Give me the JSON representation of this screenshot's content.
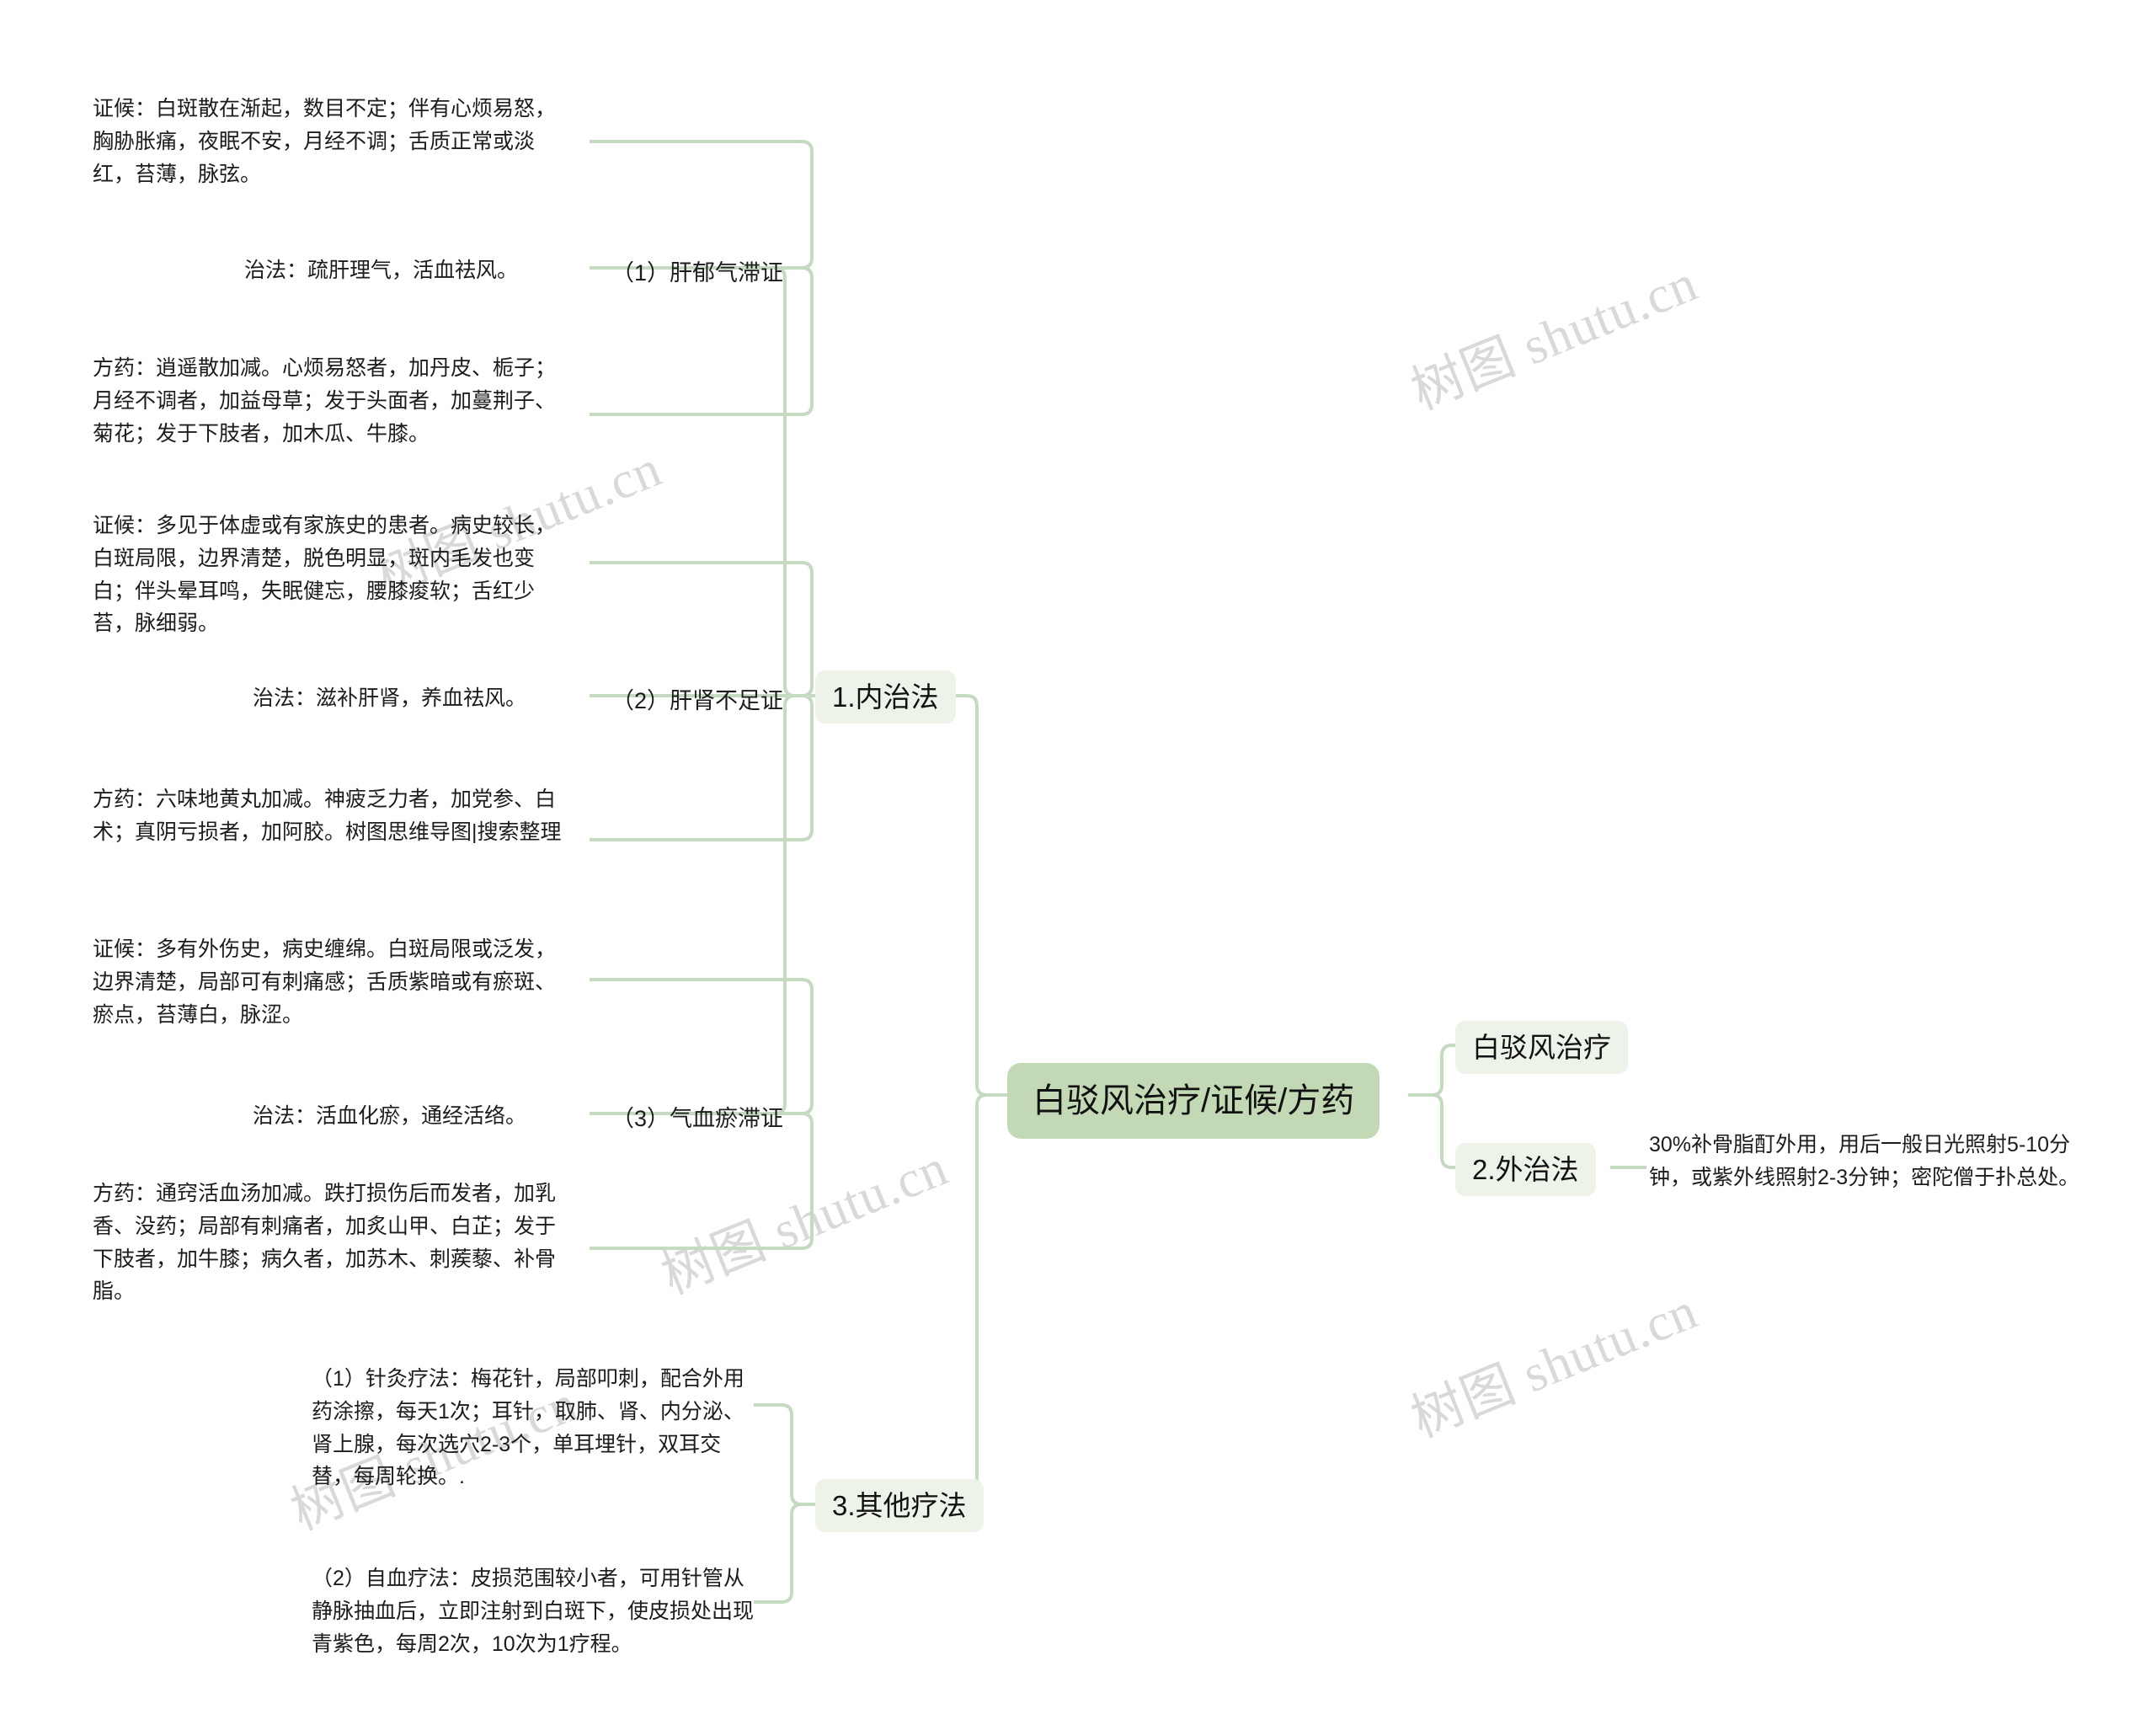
{
  "meta": {
    "diagram_type": "mindmap",
    "root_fill": "#c3d9b5",
    "branch_fill": "#edf3e9",
    "connector_color": "#c5dbc1",
    "text_color": "#1c1c1c",
    "background": "#ffffff"
  },
  "watermarks": [
    {
      "text": "树图 shutu.cn"
    },
    {
      "text": "树图 shutu.cn"
    },
    {
      "text": "树图 shutu.cn"
    },
    {
      "text": "树图 shutu.cn"
    },
    {
      "text": "树图 shutu.cn"
    }
  ],
  "root": {
    "label": "白驳风治疗/证候/方药"
  },
  "branches": [
    {
      "id": "internal",
      "label": "1.内治法",
      "children": [
        {
          "label": "（1）肝郁气滞证",
          "details": [
            {
              "kind": "zhenghou",
              "text": "证候：白斑散在渐起，数目不定；伴有心烦易怒，胸胁胀痛，夜眠不安，月经不调；舌质正常或淡红，苔薄，脉弦。"
            },
            {
              "kind": "zhifa",
              "text": "治法：疏肝理气，活血祛风。"
            },
            {
              "kind": "fangyao",
              "text": "方药：逍遥散加减。心烦易怒者，加丹皮、栀子；月经不调者，加益母草；发于头面者，加蔓荆子、菊花；发于下肢者，加木瓜、牛膝。"
            }
          ]
        },
        {
          "label": "（2）肝肾不足证",
          "details": [
            {
              "kind": "zhenghou",
              "text": "证候：多见于体虚或有家族史的患者。病史较长，白斑局限，边界清楚，脱色明显，斑内毛发也变白；伴头晕耳鸣，失眠健忘，腰膝痠软；舌红少苔，脉细弱。"
            },
            {
              "kind": "zhifa",
              "text": "治法：滋补肝肾，养血祛风。"
            },
            {
              "kind": "fangyao",
              "text": "方药：六味地黄丸加减。神疲乏力者，加党参、白术；真阴亏损者，加阿胶。树图思维导图|搜索整理"
            }
          ]
        },
        {
          "label": "（3）气血瘀滞证",
          "details": [
            {
              "kind": "zhenghou",
              "text": "证候：多有外伤史，病史缠绵。白斑局限或泛发，边界清楚，局部可有刺痛感；舌质紫暗或有瘀斑、瘀点，苔薄白，脉涩。"
            },
            {
              "kind": "zhifa",
              "text": "治法：活血化瘀，通经活络。"
            },
            {
              "kind": "fangyao",
              "text": "方药：通窍活血汤加减。跌打损伤后而发者，加乳香、没药；局部有刺痛者，加炙山甲、白芷；发于下肢者，加牛膝；病久者，加苏木、刺蒺藜、补骨脂。"
            }
          ]
        }
      ]
    },
    {
      "id": "external-title",
      "label": "白驳风治疗",
      "children": []
    },
    {
      "id": "external",
      "label": "2.外治法",
      "children": [
        {
          "label": "30%补骨脂酊外用，用后一般日光照射5-10分钟，或紫外线照射2-3分钟；密陀僧于扑总处。",
          "details": []
        }
      ]
    },
    {
      "id": "other",
      "label": "3.其他疗法",
      "children": [
        {
          "label": "（1）针灸疗法：梅花针，局部叩刺，配合外用药涂擦，每天1次；耳针，取肺、肾、内分泌、肾上腺，每次选穴2-3个，单耳埋针，双耳交替，每周轮换。.",
          "details": []
        },
        {
          "label": "（2）自血疗法：皮损范围较小者，可用针管从静脉抽血后，立即注射到白斑下，使皮损处出现青紫色，每周2次，10次为1疗程。",
          "details": []
        }
      ]
    }
  ]
}
